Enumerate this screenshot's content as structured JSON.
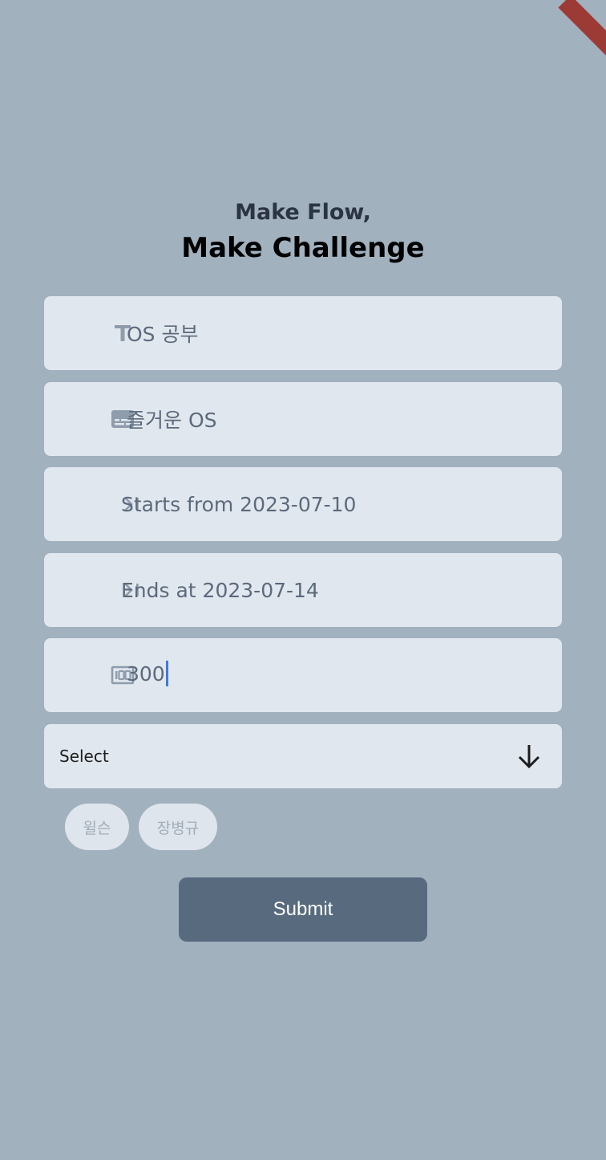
{
  "header": {
    "line1": "Make Flow,",
    "line2": "Make Challenge"
  },
  "form": {
    "title_value": "OS 공부",
    "description_value": "즐거운 OS",
    "start_value": "Starts from 2023-07-10",
    "end_value": "Ends at 2023-07-14",
    "amount_value": "300"
  },
  "select": {
    "label": "Select"
  },
  "chips": [
    "윌슨",
    "장병규"
  ],
  "submit_label": "Submit",
  "colors": {
    "background": "#a1b1be",
    "field": "#e1e7ee",
    "button": "#586b7e",
    "caret": "#3d7bd8"
  },
  "icons": {
    "title_field": "text-fields-icon",
    "description_field": "subtitles-icon",
    "start_field": "last-page-icon",
    "end_field": "last-page-icon",
    "amount_field": "money-icon",
    "select_arrow": "arrow-down-icon"
  }
}
